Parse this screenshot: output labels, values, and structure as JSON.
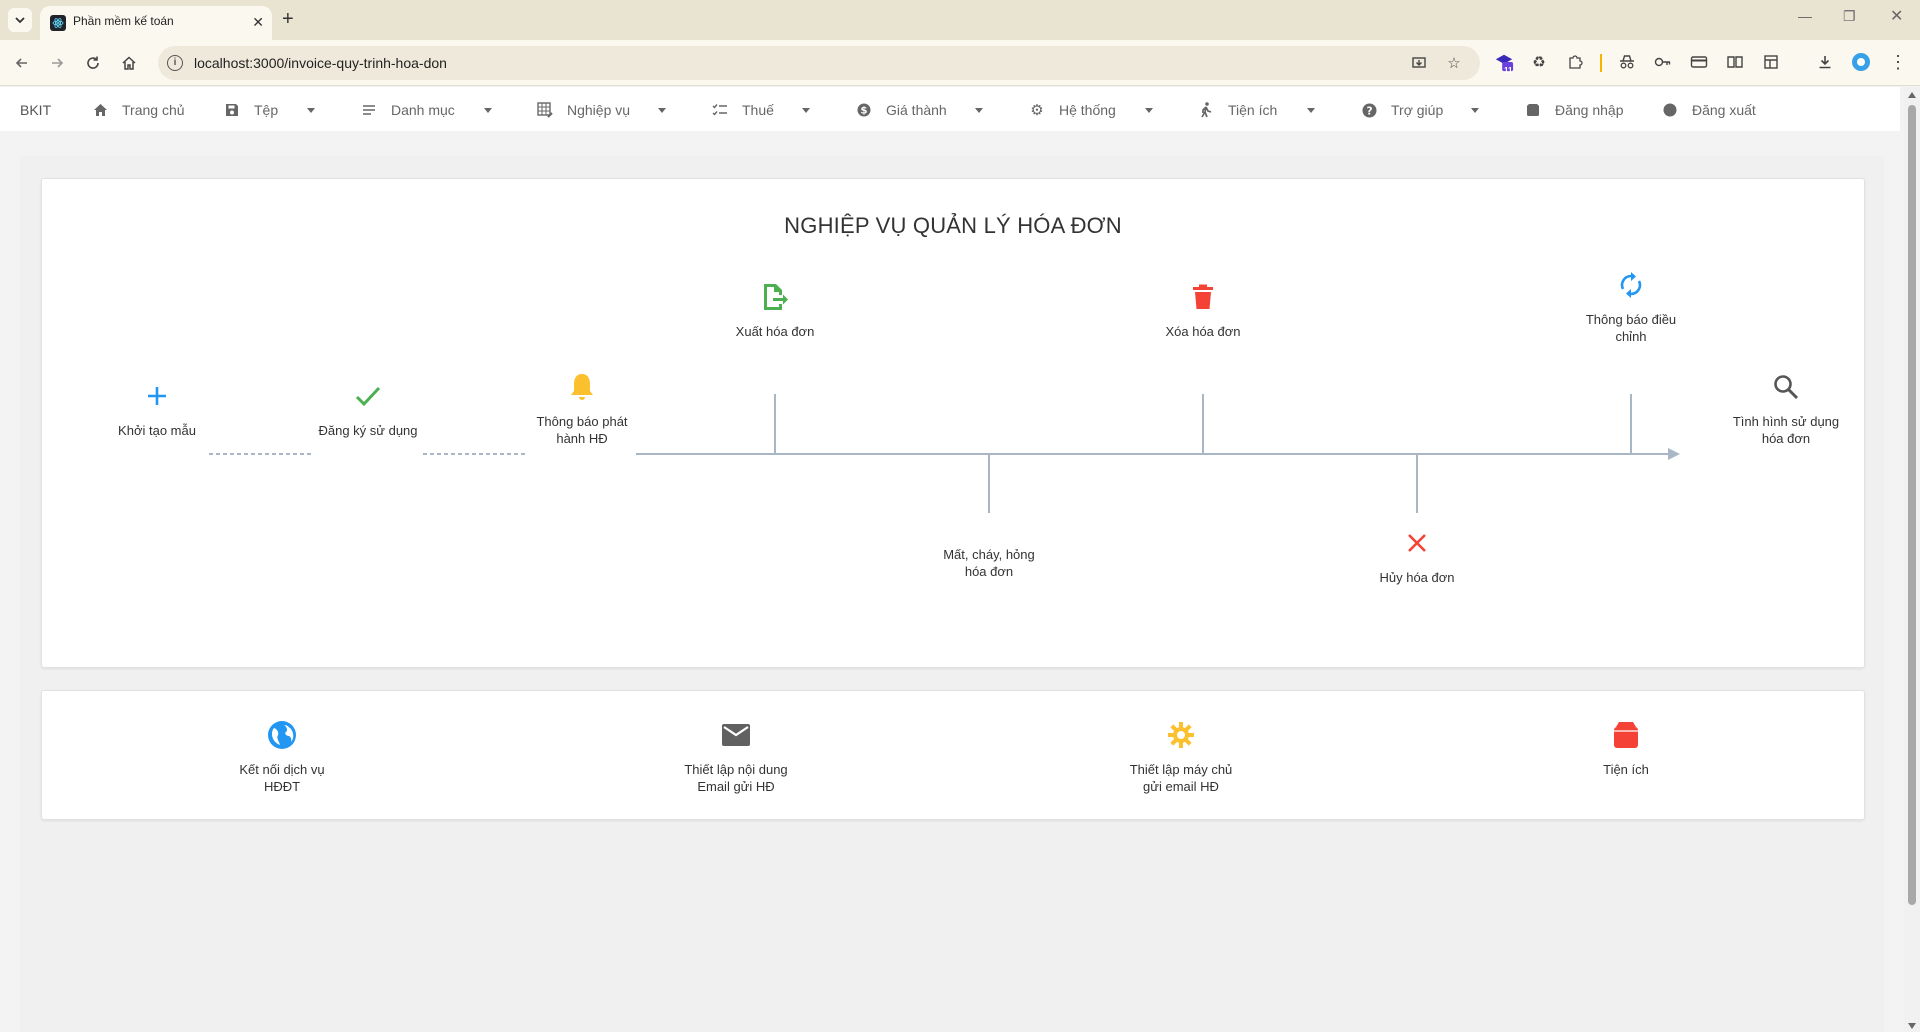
{
  "browser": {
    "tab_title": "Phần mềm kế toán",
    "url": "localhost:3000/invoice-quy-trinh-hoa-don",
    "extension_badge": "11"
  },
  "nav": {
    "brand": "BKIT",
    "items": [
      {
        "label": "Trang chủ",
        "icon": "home-icon"
      },
      {
        "label": "Tệp",
        "icon": "save-icon"
      },
      {
        "label": "Danh mục",
        "icon": "list-icon"
      },
      {
        "label": "Nghiệp vụ",
        "icon": "table-edit-icon"
      },
      {
        "label": "Thuế",
        "icon": "checklist-icon"
      },
      {
        "label": "Giá thành",
        "icon": "dollar-icon"
      },
      {
        "label": "Hệ thống",
        "icon": "gear-icon"
      },
      {
        "label": "Tiện ích",
        "icon": "walk-icon"
      },
      {
        "label": "Trợ giúp",
        "icon": "help-icon"
      },
      {
        "label": "Đăng nhập",
        "icon": "login-icon"
      },
      {
        "label": "Đăng xuất",
        "icon": "logout-icon"
      }
    ]
  },
  "process": {
    "title": "NGHIỆP VỤ QUẢN LÝ HÓA ĐƠN",
    "steps": {
      "khoi_tao": "Khởi tạo mẫu",
      "dang_ky": "Đăng ký sử dụng",
      "thong_bao_phat_hanh": "Thông báo phát hành HĐ",
      "xuat": "Xuất hóa đơn",
      "mat_chay": "Mất, cháy, hỏng hóa đơn",
      "xoa": "Xóa hóa đơn",
      "huy": "Hủy hóa đơn",
      "thong_bao_dieu_chinh": "Thông báo điều chỉnh",
      "tinh_hinh": "Tình hình sử dụng hóa đơn"
    },
    "colors": {
      "blue": "#2196f3",
      "green": "#4caf50",
      "yellow": "#fbc02d",
      "red": "#f44336",
      "line": "#a9b6c5"
    }
  },
  "utilities": {
    "items": [
      {
        "label": "Kết nối dịch vụ HĐĐT",
        "icon": "globe-icon"
      },
      {
        "label": "Thiết lập nội dung Email gửi HĐ",
        "icon": "email-icon"
      },
      {
        "label": "Thiết lập máy chủ gửi email HĐ",
        "icon": "sun-gear-icon"
      },
      {
        "label": "Tiện ích",
        "icon": "archive-icon"
      }
    ]
  }
}
